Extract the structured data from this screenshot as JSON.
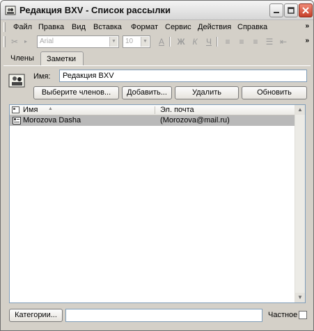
{
  "window": {
    "title": "Редакция BXV - Список рассылки",
    "icon": "distribution-list-icon"
  },
  "menu": {
    "items": [
      "Файл",
      "Правка",
      "Вид",
      "Вставка",
      "Формат",
      "Сервис",
      "Действия",
      "Справка"
    ],
    "overflow": "»"
  },
  "toolbar": {
    "font_name": "Arial",
    "font_size": "10",
    "bold": "Ж",
    "italic": "К",
    "underline": "Ч"
  },
  "tabs": [
    {
      "label": "Члены",
      "active": true
    },
    {
      "label": "Заметки",
      "active": false
    }
  ],
  "name": {
    "label": "Имя:",
    "value": "Редакция BXV"
  },
  "buttons": {
    "select_members": "Выберите членов...",
    "add": "Добавить...",
    "remove": "Удалить",
    "refresh": "Обновить"
  },
  "list": {
    "columns": [
      "Имя",
      "Эл. почта"
    ],
    "rows": [
      {
        "name": "Morozova Dasha",
        "email": "(Morozova@mail.ru)",
        "selected": true
      }
    ]
  },
  "footer": {
    "categories_button": "Категории...",
    "categories_value": "",
    "private_label": "Частное",
    "private_checked": false
  },
  "colors": {
    "window_bg": "#d4d0c8",
    "selected_row": "#b9b9b9",
    "field_border": "#7f9db9"
  }
}
